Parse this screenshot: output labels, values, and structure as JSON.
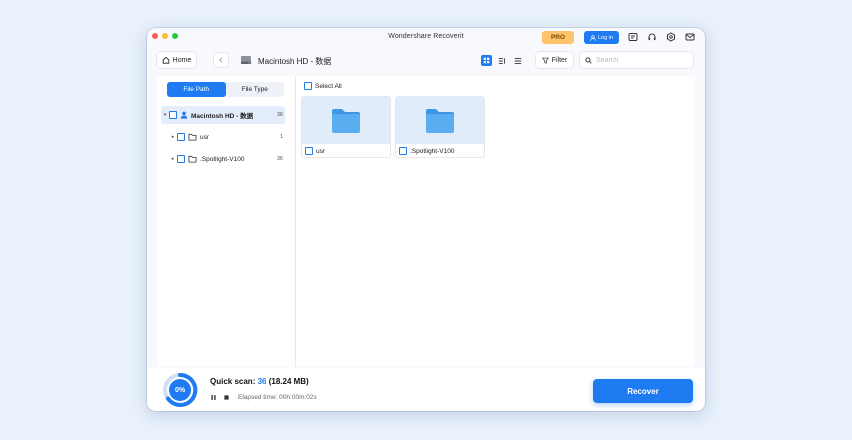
{
  "app": {
    "title": "Wondershare Recoverit",
    "pro_label": "PRO",
    "login_label": "Log in"
  },
  "toolbar": {
    "home_label": "Home",
    "breadcrumb": "Macintosh HD - 数据",
    "filter_label": "Filter",
    "search_placeholder": "Search"
  },
  "sidebar": {
    "tabs": [
      {
        "label": "File Path",
        "active": true
      },
      {
        "label": "File Type",
        "active": false
      }
    ],
    "tree": [
      {
        "label": "Macintosh HD - 数据",
        "count": "36"
      },
      {
        "label": "usr",
        "count": "1"
      },
      {
        "label": ".Spotlight-V100",
        "count": "36"
      }
    ]
  },
  "main": {
    "select_all_label": "Select All",
    "items": [
      {
        "name": "usr"
      },
      {
        "name": ".Spotlight-V100"
      }
    ]
  },
  "footer": {
    "progress_percent": 0,
    "progress_label": "0%",
    "scan_prefix": "Quick scan: ",
    "scan_count": "36",
    "scan_size": " (18.24 MB)",
    "elapsed": "Elapsed time: 00h:00m:02s",
    "recover_label": "Recover"
  },
  "colors": {
    "accent": "#1f7bf2",
    "pro": "#ffc46b",
    "folder": "#5aaef0"
  }
}
